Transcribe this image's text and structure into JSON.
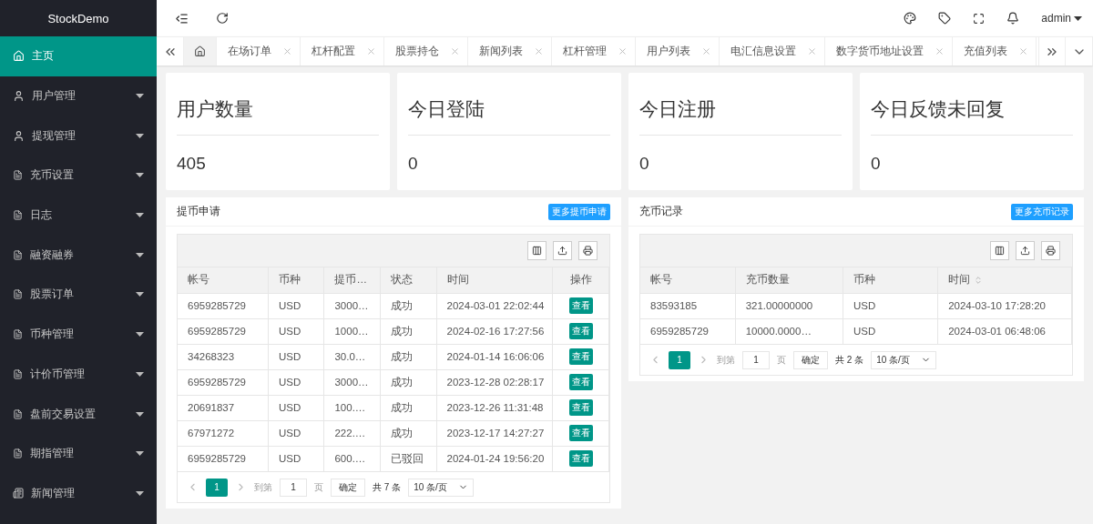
{
  "brand": "StockDemo",
  "sidebar": {
    "items": [
      {
        "label": "主页",
        "kind": "home",
        "selected": true,
        "has_caret": false
      },
      {
        "label": "用户管理",
        "kind": "user",
        "selected": false,
        "has_caret": true
      },
      {
        "label": "提现管理",
        "kind": "user",
        "selected": false,
        "has_caret": true
      },
      {
        "label": "充币设置",
        "kind": "doc",
        "selected": false,
        "has_caret": true
      },
      {
        "label": "日志",
        "kind": "doc",
        "selected": false,
        "has_caret": true
      },
      {
        "label": "融资融券",
        "kind": "doc",
        "selected": false,
        "has_caret": true
      },
      {
        "label": "股票订单",
        "kind": "doc",
        "selected": false,
        "has_caret": true
      },
      {
        "label": "币种管理",
        "kind": "doc",
        "selected": false,
        "has_caret": true
      },
      {
        "label": "计价币管理",
        "kind": "doc",
        "selected": false,
        "has_caret": true
      },
      {
        "label": "盘前交易设置",
        "kind": "doc",
        "selected": false,
        "has_caret": true
      },
      {
        "label": "期指管理",
        "kind": "doc",
        "selected": false,
        "has_caret": true
      },
      {
        "label": "新闻管理",
        "kind": "news",
        "selected": false,
        "has_caret": true
      }
    ]
  },
  "topbar": {
    "user": "admin"
  },
  "home_tab": {
    "selected": true
  },
  "tabs": [
    {
      "label": "在场订单",
      "selected": false
    },
    {
      "label": "杠杆配置",
      "selected": false
    },
    {
      "label": "股票持仓",
      "selected": false
    },
    {
      "label": "新闻列表",
      "selected": false
    },
    {
      "label": "杠杆管理",
      "selected": false
    },
    {
      "label": "用户列表",
      "selected": false
    },
    {
      "label": "电汇信息设置",
      "selected": false
    },
    {
      "label": "数字货币地址设置",
      "selected": false
    },
    {
      "label": "充值列表",
      "selected": false
    }
  ],
  "stats": [
    {
      "title": "用户数量",
      "value": "405"
    },
    {
      "title": "今日登陆",
      "value": "0"
    },
    {
      "title": "今日注册",
      "value": "0"
    },
    {
      "title": "今日反馈未回复",
      "value": "0"
    }
  ],
  "panels": [
    {
      "title": "提币申请",
      "more": "更多提币申请",
      "columns": [
        {
          "label": "帐号",
          "sortable": false
        },
        {
          "label": "币种",
          "sortable": false
        },
        {
          "label": "提币…",
          "sortable": false
        },
        {
          "label": "状态",
          "sortable": false
        },
        {
          "label": "时间",
          "sortable": false
        },
        {
          "label": "操作",
          "sortable": false
        }
      ],
      "rows": [
        {
          "cells": [
            "6959285729",
            "USD",
            "3000…",
            "成功",
            "2024-03-01 22:02:44"
          ],
          "action": "查看"
        },
        {
          "cells": [
            "6959285729",
            "USD",
            "1000…",
            "成功",
            "2024-02-16 17:27:56"
          ],
          "action": "查看"
        },
        {
          "cells": [
            "34268323",
            "USD",
            "30.0…",
            "成功",
            "2024-01-14 16:06:06"
          ],
          "action": "查看"
        },
        {
          "cells": [
            "6959285729",
            "USD",
            "3000…",
            "成功",
            "2023-12-28 02:28:17"
          ],
          "action": "查看"
        },
        {
          "cells": [
            "20691837",
            "USD",
            "100.…",
            "成功",
            "2023-12-26 11:31:48"
          ],
          "action": "查看"
        },
        {
          "cells": [
            "67971272",
            "USD",
            "222.…",
            "成功",
            "2023-12-17 14:27:27"
          ],
          "action": "查看"
        },
        {
          "cells": [
            "6959285729",
            "USD",
            "600.…",
            "已驳回",
            "2024-01-24 19:56:20"
          ],
          "action": "查看"
        }
      ],
      "pagination": {
        "current": "1",
        "goto": "到第",
        "page": "1",
        "unit": "页",
        "confirm": "确定",
        "total": "共 7 条",
        "size": "10 条/页"
      }
    },
    {
      "title": "充币记录",
      "more": "更多充币记录",
      "columns": [
        {
          "label": "帐号",
          "sortable": false
        },
        {
          "label": "充币数量",
          "sortable": false
        },
        {
          "label": "币种",
          "sortable": false
        },
        {
          "label": "时间",
          "sortable": true
        }
      ],
      "rows": [
        {
          "cells": [
            "83593185",
            "321.00000000",
            "USD",
            "2024-03-10 17:28:20"
          ]
        },
        {
          "cells": [
            "6959285729",
            "10000.0000…",
            "USD",
            "2024-03-01 06:48:06"
          ]
        }
      ],
      "pagination": {
        "current": "1",
        "goto": "到第",
        "page": "1",
        "unit": "页",
        "confirm": "确定",
        "total": "共 2 条",
        "size": "10 条/页"
      }
    }
  ]
}
